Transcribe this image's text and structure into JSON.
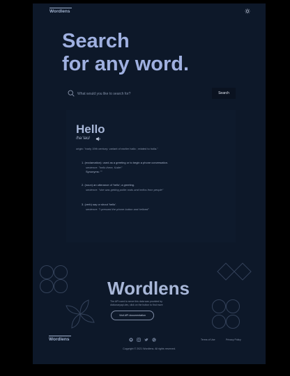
{
  "header": {
    "logo": "Wordlens"
  },
  "hero": {
    "line1": "Search",
    "line2": "for any word."
  },
  "search": {
    "placeholder": "What would you like to search for?",
    "button_label": "Search"
  },
  "entry": {
    "word": "Hello",
    "phonetic": "/həˈləʊ/",
    "origin": "origin: \"early 19th century: variant of earlier hallo ; related to holla.\"",
    "meanings": [
      {
        "definition": "1. (exclamation): used as a greeting or to begin a phone conversation.",
        "example": "sentence: \"hello there, Katie!\"",
        "synonyms": "Synonyms: \"\""
      },
      {
        "definition": "2. (noun) an utterance of 'hello'; a greeting.",
        "example": "sentence: \"she was getting polite nods and hellos from people\""
      },
      {
        "definition": "3. (verb) say or shout 'hello'.",
        "example": "sentence: \"I pressed the phone button and helloed\""
      }
    ]
  },
  "footer": {
    "big_logo": "Wordlens",
    "api_note_line1": "The API used to serve this data was provided by",
    "api_note_line2": "dictionaryapi.dev, click on the button to find more",
    "api_button": "Visit API documentation",
    "logo": "Wordlens",
    "terms": "Terms of Use",
    "privacy": "Privacy Policy",
    "copyright": "Copyright © 2021 Wordlens. All rights reserved.",
    "social_icons": [
      "github-icon",
      "instagram-icon",
      "twitter-icon",
      "dribbble-icon"
    ]
  },
  "colors": {
    "page_bg": "#0d1829",
    "accent": "#9fb0e0",
    "outer_bg": "#000000"
  }
}
